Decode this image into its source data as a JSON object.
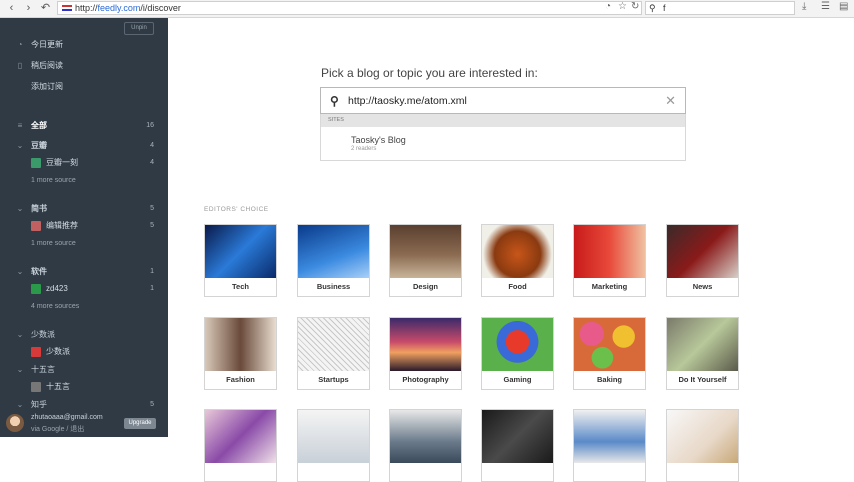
{
  "browser": {
    "url_scheme": "http://",
    "url_host": "feedly.com",
    "url_path": "/i/discover",
    "search_text": "f"
  },
  "sidebar": {
    "unpin_label": "Unpin",
    "nav": [
      {
        "label": "今日更新",
        "icon": "today-icon"
      },
      {
        "label": "稍后阅读",
        "icon": "bookmark-icon"
      },
      {
        "label": "添加订阅",
        "icon": ""
      }
    ],
    "all": {
      "label": "全部",
      "count": "16"
    },
    "categories": [
      {
        "label": "豆瓣",
        "count": "4"
      },
      {
        "label": "简书",
        "count": "5"
      },
      {
        "label": "软件",
        "count": "1"
      },
      {
        "label": "少数派",
        "count": ""
      },
      {
        "label": "十五言",
        "count": ""
      },
      {
        "label": "知乎",
        "count": "5"
      }
    ],
    "feeds": [
      {
        "label": "豆瓣一刻",
        "count": "4",
        "color": "#3a9a6a"
      },
      {
        "label": "编辑推荐",
        "count": "5",
        "color": "#c06060"
      },
      {
        "label": "zd423",
        "count": "1",
        "color": "#2a9a4a"
      },
      {
        "label": "少数派",
        "count": "",
        "color": "#d83a3a"
      },
      {
        "label": "十五言",
        "count": "",
        "color": "#777777"
      }
    ],
    "more": [
      {
        "label": "1 more source"
      },
      {
        "label": "1 more source"
      },
      {
        "label": "4 more sources"
      }
    ],
    "user": {
      "email": "zhutaoaaa@gmail.com",
      "via": "via Google / 退出",
      "upgrade_label": "Upgrade"
    }
  },
  "main": {
    "prompt": "Pick a blog or topic you are interested in:",
    "search_value": "http://taosky.me/atom.xml",
    "dropdown": {
      "section_label": "SITES",
      "result_title": "Taosky's Blog",
      "result_sub": "2 readers"
    },
    "editors_choice_label": "EDITORS' CHOICE",
    "topics": [
      "Tech",
      "Business",
      "Design",
      "Food",
      "Marketing",
      "News",
      "Fashion",
      "Startups",
      "Photography",
      "Gaming",
      "Baking",
      "Do It Yourself"
    ]
  }
}
